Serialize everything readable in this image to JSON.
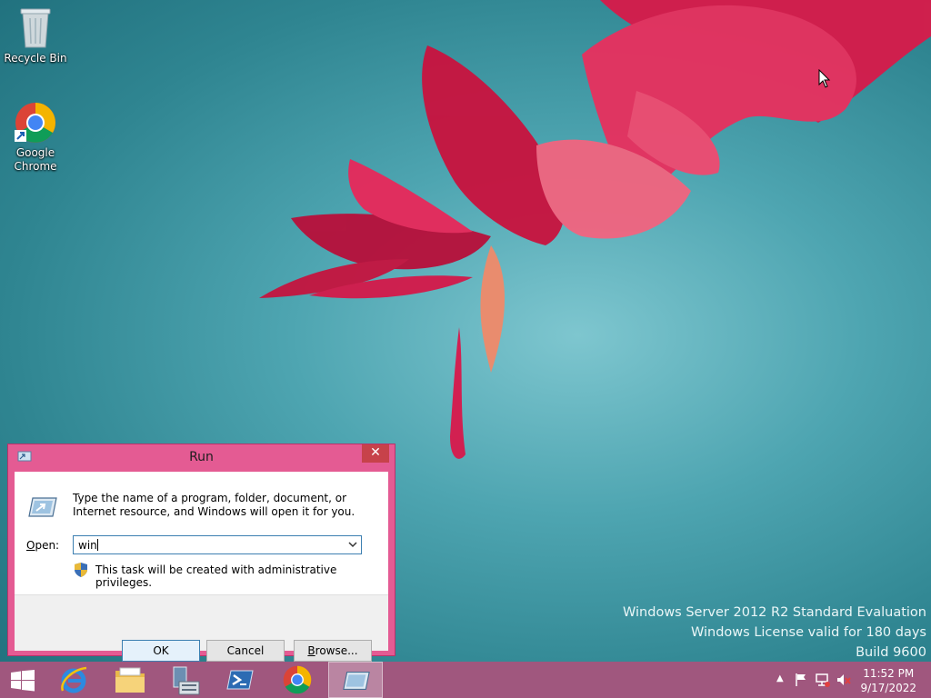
{
  "desktop": {
    "icons": [
      {
        "label": "Recycle Bin"
      },
      {
        "label": "Google Chrome"
      }
    ],
    "watermark": {
      "line1": "Windows Server 2012 R2 Standard Evaluation",
      "line2": "Windows License valid for 180 days",
      "line3": "Build 9600"
    }
  },
  "run_dialog": {
    "title": "Run",
    "close_label": "✕",
    "description": "Type the name of a program, folder, document, or Internet resource, and Windows will open it for you.",
    "open_label": "Open:",
    "open_value": "win",
    "admin_note": "This task will be created with administrative privileges.",
    "buttons": {
      "ok": "OK",
      "cancel": "Cancel",
      "browse": "Browse..."
    }
  },
  "taskbar": {
    "apps": [
      {
        "icon": "windows-logo-icon"
      },
      {
        "icon": "internet-explorer-icon"
      },
      {
        "icon": "file-explorer-icon"
      },
      {
        "icon": "server-manager-icon"
      },
      {
        "icon": "powershell-icon"
      },
      {
        "icon": "chrome-icon"
      },
      {
        "icon": "run-icon",
        "active": true
      }
    ],
    "tray": {
      "time": "11:52 PM",
      "date": "9/17/2022"
    }
  },
  "colors": {
    "taskbar": "#a0577e",
    "dialog_frame": "#e45b93",
    "close_button": "#c7424a"
  }
}
